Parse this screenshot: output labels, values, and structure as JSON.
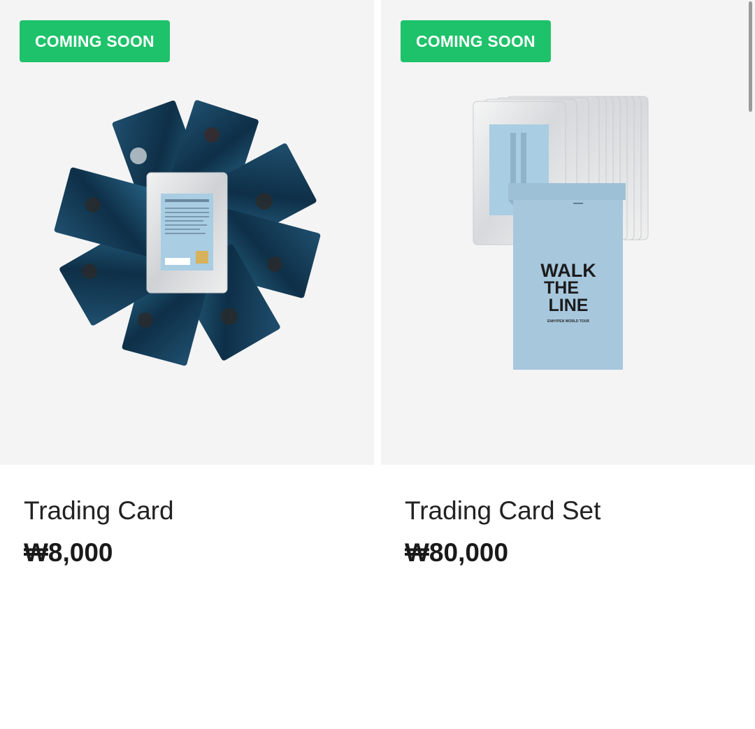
{
  "products": [
    {
      "badge": "COMING SOON",
      "title": "Trading Card",
      "price": "₩8,000",
      "image_icon": "trading-card-pack-image"
    },
    {
      "badge": "COMING SOON",
      "title": "Trading Card Set",
      "price": "₩80,000",
      "image_icon": "trading-card-set-image",
      "envelope_text": [
        "WALK",
        "THE",
        "LINE"
      ],
      "envelope_subtext": "ENHYPEN WORLD TOUR"
    }
  ],
  "colors": {
    "badge_bg": "#1ec26a",
    "image_bg": "#f4f4f5",
    "envelope_blue": "#a7c7dd"
  }
}
